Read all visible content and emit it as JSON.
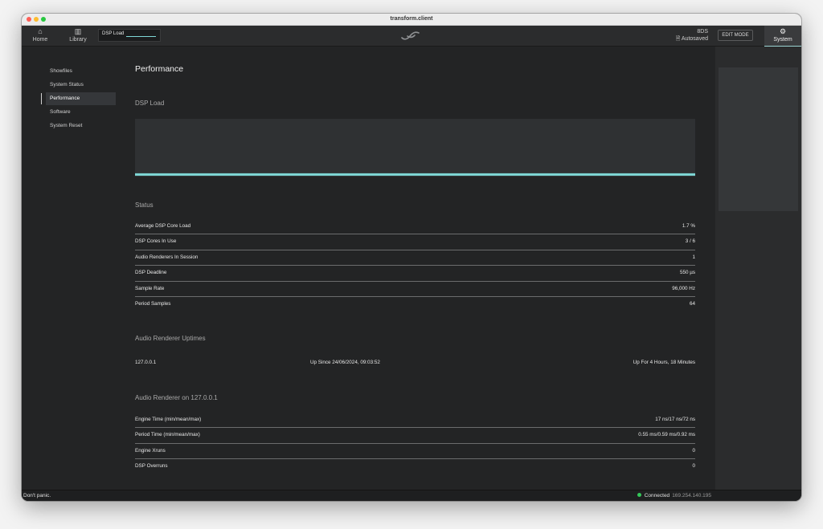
{
  "window": {
    "title": "transform.client"
  },
  "toolbar": {
    "home_label": "Home",
    "library_label": "Library",
    "dsp_load_label": "DSP Load",
    "project_name": "8DS",
    "project_status": "Autosaved",
    "edit_mode_label": "EDIT MODE",
    "system_label": "System"
  },
  "sidebar": {
    "items": [
      {
        "label": "Showfiles"
      },
      {
        "label": "System Status"
      },
      {
        "label": "Performance"
      },
      {
        "label": "Software"
      },
      {
        "label": "System Reset"
      }
    ],
    "active_index": 2
  },
  "main": {
    "page_title": "Performance",
    "dsp_load_title": "DSP Load",
    "status_title": "Status",
    "status_rows": [
      {
        "label": "Average DSP Core Load",
        "value": "1.7 %"
      },
      {
        "label": "DSP Cores In Use",
        "value": "3 / 6"
      },
      {
        "label": "Audio Renderers In Session",
        "value": "1"
      },
      {
        "label": "DSP Deadline",
        "value": "550 µs"
      },
      {
        "label": "Sample Rate",
        "value": "96,000 Hz"
      },
      {
        "label": "Period Samples",
        "value": "64"
      }
    ],
    "uptimes_title": "Audio Renderer Uptimes",
    "uptime": {
      "host": "127.0.0.1",
      "since": "Up Since 24/06/2024, 09:03:52",
      "duration": "Up For 4 Hours, 18 Minutes"
    },
    "renderer_title": "Audio Renderer on 127.0.0.1",
    "renderer_rows": [
      {
        "label": "Engine Time (min/mean/max)",
        "value": "17 ns/17 ns/72 ns"
      },
      {
        "label": "Period Time (min/mean/max)",
        "value": "0.55 ms/0.59 ms/0.92 ms"
      },
      {
        "label": "Engine Xruns",
        "value": "0"
      },
      {
        "label": "DSP Overruns",
        "value": "0"
      }
    ]
  },
  "dsp_chart": {
    "load_percent": 1.7,
    "line_color": "#7fd8d6"
  },
  "statusbar": {
    "left_text": "Don't panic.",
    "connection": "Connected",
    "ip": "169.254.140.195"
  },
  "colors": {
    "accent": "#7fd8d6",
    "connected": "#34c759",
    "background": "#232425"
  },
  "icons": {
    "home": "home-icon",
    "library": "library-icon",
    "logo": "logo-icon",
    "document": "document-icon",
    "system": "gear-icon"
  }
}
